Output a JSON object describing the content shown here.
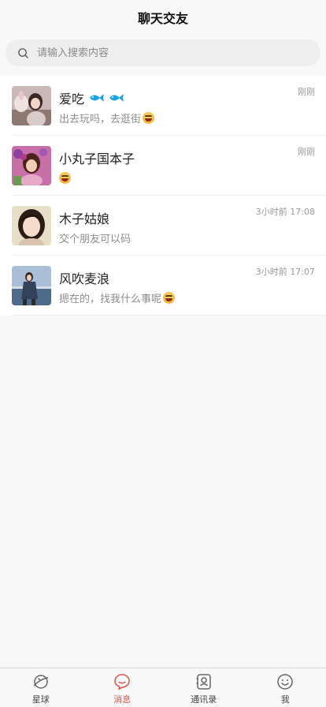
{
  "header": {
    "title": "聊天交友"
  },
  "search": {
    "placeholder": "请输入搜索内容",
    "icon": "search-icon"
  },
  "chats": [
    {
      "name": "爱吃",
      "preview": "出去玩吗，去逛街",
      "time": "刚刚",
      "badges": [
        "fish-icon",
        "fish-icon"
      ],
      "emoji": "grin-emoji"
    },
    {
      "name": "小丸子国本子",
      "preview": "",
      "time": "刚刚",
      "badges": [],
      "emoji": "smile-emoji"
    },
    {
      "name": "木子姑娘",
      "preview": "交个朋友可以码",
      "time": "3小时前 17:08",
      "badges": [],
      "emoji": ""
    },
    {
      "name": "风吹麦浪",
      "preview": "摁在的，找我什么事呢",
      "time": "3小时前 17:07",
      "badges": [],
      "emoji": "smile-emoji"
    }
  ],
  "tabbar": {
    "items": [
      {
        "label": "星球",
        "icon": "planet-icon"
      },
      {
        "label": "消息",
        "icon": "message-icon",
        "active": true
      },
      {
        "label": "通讯录",
        "icon": "contacts-icon"
      },
      {
        "label": "我",
        "icon": "smiley-face-icon"
      }
    ]
  },
  "colors": {
    "accent": "#e0534a",
    "fish_badge": "#1aa3e8"
  }
}
